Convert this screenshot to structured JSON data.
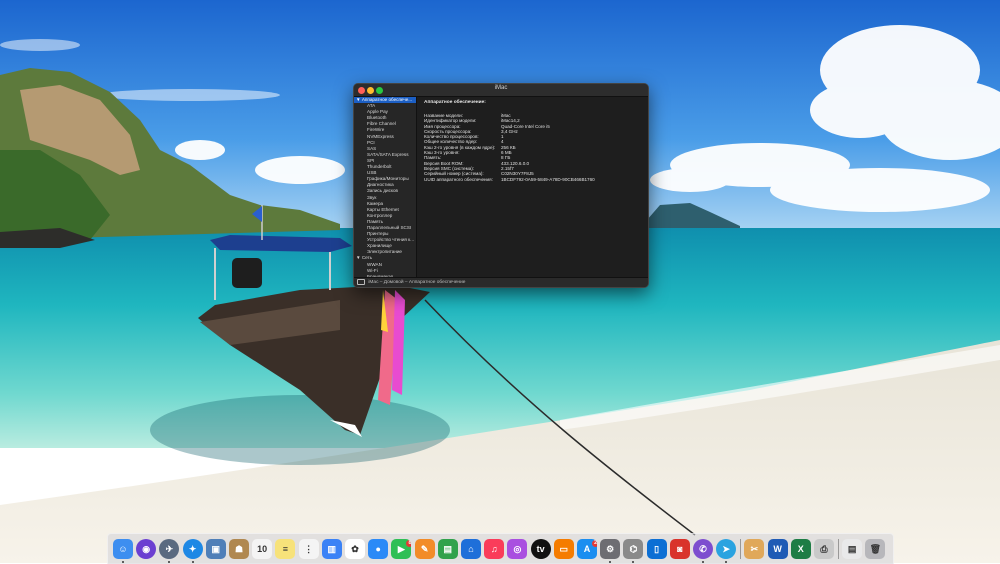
{
  "window": {
    "title": "iMac",
    "content_heading": "Аппаратное обеспечение:",
    "status_path": "iMac – Домовой – Аппаратное обеспечение"
  },
  "sidebar": {
    "rows": [
      {
        "label": "▼ Аппаратное обеспече...",
        "type": "cat",
        "selected": true
      },
      {
        "label": "ATA",
        "type": "item"
      },
      {
        "label": "Apple Pay",
        "type": "item"
      },
      {
        "label": "Bluetooth",
        "type": "item"
      },
      {
        "label": "Fibre Channel",
        "type": "item"
      },
      {
        "label": "FireWire",
        "type": "item"
      },
      {
        "label": "NVMExpress",
        "type": "item"
      },
      {
        "label": "PCI",
        "type": "item"
      },
      {
        "label": "SAS",
        "type": "item"
      },
      {
        "label": "SATA/SATA Express",
        "type": "item"
      },
      {
        "label": "SPI",
        "type": "item"
      },
      {
        "label": "Thunderbolt",
        "type": "item"
      },
      {
        "label": "USB",
        "type": "item"
      },
      {
        "label": "Графика/Мониторы",
        "type": "item"
      },
      {
        "label": "Диагностика",
        "type": "item"
      },
      {
        "label": "Запись дисков",
        "type": "item"
      },
      {
        "label": "Звук",
        "type": "item"
      },
      {
        "label": "Камера",
        "type": "item"
      },
      {
        "label": "Карты Ethernet",
        "type": "item"
      },
      {
        "label": "Контроллер",
        "type": "item"
      },
      {
        "label": "Память",
        "type": "item"
      },
      {
        "label": "Параллельный SCSI",
        "type": "item"
      },
      {
        "label": "Принтеры",
        "type": "item"
      },
      {
        "label": "Устройство чтения к...",
        "type": "item"
      },
      {
        "label": "Хранилище",
        "type": "item"
      },
      {
        "label": "Электропитание",
        "type": "item"
      },
      {
        "label": "▼ Сеть",
        "type": "cat"
      },
      {
        "label": "WWAN",
        "type": "item"
      },
      {
        "label": "Wi-Fi",
        "type": "item"
      },
      {
        "label": "Брандмауэр",
        "type": "item"
      }
    ]
  },
  "properties": [
    {
      "key": "Название модели:",
      "value": "iMac"
    },
    {
      "key": "Идентификатор модели:",
      "value": "iMac14,2"
    },
    {
      "key": "Имя процессора:",
      "value": "Quad-Core Intel Core i5"
    },
    {
      "key": "Скорость процессора:",
      "value": "3,4 GHz"
    },
    {
      "key": "Количество процессоров:",
      "value": "1"
    },
    {
      "key": "Общее количество ядер:",
      "value": "4"
    },
    {
      "key": "Кэш 2-го уровня (в каждом ядре):",
      "value": "256 КБ"
    },
    {
      "key": "Кэш 3-го уровня:",
      "value": "6 МБ"
    },
    {
      "key": "Память:",
      "value": "8 ГБ"
    },
    {
      "key": "Версия Boot ROM:",
      "value": "433.120.6.0.0"
    },
    {
      "key": "Версия SMC (система):",
      "value": "2.15f7"
    },
    {
      "key": "Серийный номер (система):",
      "value": "C02N30Y7F8J5"
    },
    {
      "key": "UUID аппаратного обеспечения:",
      "value": "1BCDF792-0A59-5849-A78D-90CB466B1760"
    }
  ],
  "dock": {
    "apps": [
      {
        "icon": "finder-icon",
        "color": "#3d8ef0",
        "glyph": "☺",
        "round": false
      },
      {
        "icon": "siri-icon",
        "color": "#6b3fd1",
        "glyph": "◉",
        "round": true
      },
      {
        "icon": "launchpad-icon",
        "color": "#5a6a80",
        "glyph": "✈",
        "round": true
      },
      {
        "icon": "safari-icon",
        "color": "#1e88e5",
        "glyph": "✦",
        "round": true
      },
      {
        "icon": "preview-icon",
        "color": "#4f7fb8",
        "glyph": "▣",
        "round": false
      },
      {
        "icon": "contacts-icon",
        "color": "#b08850",
        "glyph": "☗",
        "round": false
      },
      {
        "icon": "calendar-icon",
        "color": "#f4f4f4",
        "glyph": "10",
        "round": false,
        "dark": true
      },
      {
        "icon": "notes-icon",
        "color": "#f7e27a",
        "glyph": "≡",
        "round": false,
        "dark": true
      },
      {
        "icon": "reminders-icon",
        "color": "#f4f4f4",
        "glyph": "⋮",
        "round": false,
        "dark": true
      },
      {
        "icon": "keynote-icon",
        "color": "#3b82f6",
        "glyph": "▥",
        "round": false
      },
      {
        "icon": "photos-icon",
        "color": "#ffffff",
        "glyph": "✿",
        "round": false,
        "dark": true
      },
      {
        "icon": "messages-icon",
        "color": "#2b8af7",
        "glyph": "●",
        "round": false
      },
      {
        "icon": "facetime-icon",
        "color": "#2fbf55",
        "glyph": "▶",
        "round": false,
        "badge": "8"
      },
      {
        "icon": "pages-icon",
        "color": "#f28c28",
        "glyph": "✎",
        "round": false
      },
      {
        "icon": "numbers-icon",
        "color": "#31a24c",
        "glyph": "▤",
        "round": false
      },
      {
        "icon": "keynote-stand-icon",
        "color": "#1e6fd9",
        "glyph": "⌂",
        "round": false
      },
      {
        "icon": "music-icon",
        "color": "#fa3c5a",
        "glyph": "♫",
        "round": false
      },
      {
        "icon": "podcasts-icon",
        "color": "#a94fe0",
        "glyph": "◎",
        "round": false
      },
      {
        "icon": "appletv-icon",
        "color": "#111111",
        "glyph": "tv",
        "round": true
      },
      {
        "icon": "books-icon",
        "color": "#f57c00",
        "glyph": "▭",
        "round": false
      },
      {
        "icon": "appstore-icon",
        "color": "#1b8ef0",
        "glyph": "A",
        "round": false,
        "badge": "2"
      },
      {
        "icon": "system-preferences-icon",
        "color": "#6d6d72",
        "glyph": "⚙",
        "round": false
      },
      {
        "icon": "system-information-icon",
        "color": "#8a8a8a",
        "glyph": "⌬",
        "round": false
      },
      {
        "icon": "trello-icon",
        "color": "#0c6fd4",
        "glyph": "▯",
        "round": false
      },
      {
        "icon": "photo-booth-icon",
        "color": "#d9332b",
        "glyph": "◙",
        "round": false
      },
      {
        "icon": "viber-icon",
        "color": "#7d4dcf",
        "glyph": "✆",
        "round": true
      },
      {
        "icon": "telegram-icon",
        "color": "#2aa3e0",
        "glyph": "➤",
        "round": true
      },
      {
        "icon": "utilities-icon",
        "color": "#e0a85a",
        "glyph": "✂",
        "round": false
      },
      {
        "icon": "word-icon",
        "color": "#1f5bb5",
        "glyph": "W",
        "round": false
      },
      {
        "icon": "excel-icon",
        "color": "#1e7d45",
        "glyph": "X",
        "round": false
      },
      {
        "icon": "printer-icon",
        "color": "#c9c9c9",
        "glyph": "⎙",
        "round": false,
        "dark": true
      },
      {
        "icon": "documents-folder-icon",
        "color": "#e9e9ea",
        "glyph": "▤",
        "round": false,
        "dark": true
      },
      {
        "icon": "trash-icon",
        "color": "#b7b7bb",
        "glyph": "🗑",
        "round": false,
        "dark": true
      }
    ]
  },
  "colors": {
    "sky_top": "#1f73d8",
    "sky_horizon": "#8cc4f0",
    "sea_far": "#17a7b8",
    "sea_near": "#5fd3cf",
    "sand": "#f1ece2",
    "selection": "#1c5fc4"
  }
}
